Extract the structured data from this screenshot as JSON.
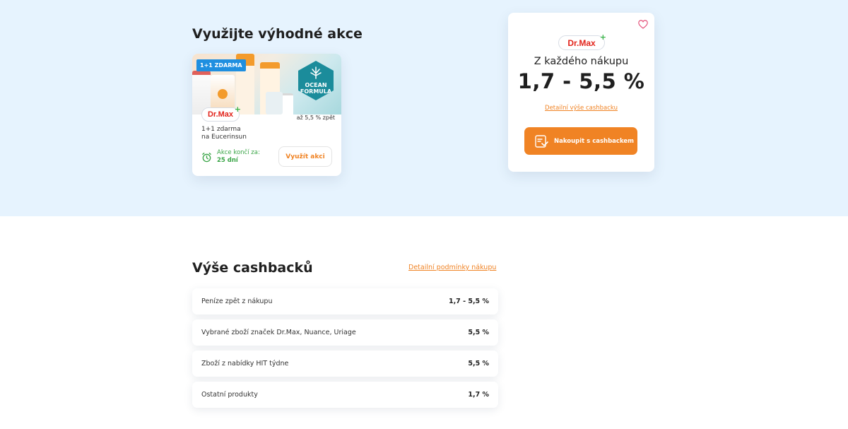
{
  "promo_section": {
    "title": "Využijte výhodné akce",
    "card": {
      "badge": "1+1 ZDARMA",
      "ocean_text_1": "OCEAN",
      "ocean_text_2": "FORMULA",
      "logo": "Dr.Max",
      "logo_plus": "+",
      "cashback": "až 5,5 % zpět",
      "desc_line1": "1+1 zdarma",
      "desc_line2": "na Eucerinsun",
      "ends_label": "Akce končí za:",
      "ends_value": "25 dní",
      "button": "Využít akci",
      "icons": {
        "clock": "alarm-clock-icon"
      },
      "colors": {
        "badge": "#1f8fe0",
        "ends": "#3aa547",
        "button_text": "#f08324"
      }
    }
  },
  "store_card": {
    "logo": "Dr.Max",
    "logo_plus": "+",
    "every_purchase": "Z každého nákupu",
    "rate": "1,7 - 5,5 %",
    "detail_link": "Detailní výše cashbacku",
    "shop_button": "Nakoupit s cashbackem",
    "icons": {
      "favorite": "heart-icon",
      "shop": "cart-cashback-icon"
    },
    "colors": {
      "accent": "#f08324",
      "logo": "#e2231a",
      "plus": "#3bb54a",
      "heart": "#e4517a"
    }
  },
  "cashback_section": {
    "title": "Výše cashbacků",
    "conditions_link": "Detailní podmínky nákupu",
    "rows": [
      {
        "label": "Peníze zpět z nákupu",
        "value": "1,7 - 5,5 %"
      },
      {
        "label": "Vybrané zboží značek Dr.Max, Nuance, Uriage",
        "value": "5,5 %"
      },
      {
        "label": "Zboží z nabídky HIT týdne",
        "value": "5,5 %"
      },
      {
        "label": "Ostatní produkty",
        "value": "1,7 %"
      }
    ]
  },
  "colors": {
    "hero_bg": "#e6f3fe",
    "page_bg": "#ffffff"
  }
}
